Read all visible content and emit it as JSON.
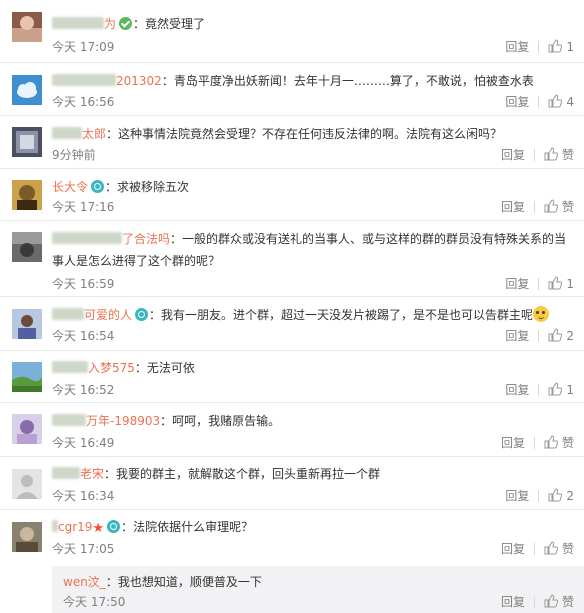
{
  "ui": {
    "reply_label": "回复",
    "like_zero_label": "赞"
  },
  "comments": [
    {
      "name_visible": "为",
      "text": "：竟然受理了",
      "time": "今天 17:09",
      "likes": "1"
    },
    {
      "name_visible": "201302",
      "text": "：青岛平度净出妖新闻！去年十月一………算了，不敢说，怕被查水表",
      "time": "今天 16:56",
      "likes": "4"
    },
    {
      "name_visible": "太郎",
      "text": "：这种事情法院竟然会受理？不存在任何违反法律的啊。法院有这么闲吗？",
      "time": "9分钟前",
      "likes": "赞"
    },
    {
      "name_visible": "长大令",
      "text": "：求被移除五次",
      "time": "今天 17:16",
      "likes": "赞"
    },
    {
      "name_visible": "了合法吗",
      "text": "：一般的群众或没有送礼的当事人、或与这样的群的群员没有特殊关系的当事人是怎么进得了这个群的呢？",
      "time": "今天 16:59",
      "likes": "1"
    },
    {
      "name_visible": "可爱的人",
      "text": "：我有一朋友。进个群，超过一天没发片被踢了，是不是也可以告群主呢",
      "time": "今天 16:54",
      "likes": "2"
    },
    {
      "name_visible": "入梦575",
      "text": "：无法可依",
      "time": "今天 16:52",
      "likes": "1"
    },
    {
      "name_visible": "万年-198903",
      "text": "：呵呵，我赌原告输。",
      "time": "今天 16:49",
      "likes": "赞"
    },
    {
      "name_visible": "老宋",
      "text": "：我要的群主，就解散这个群，回头重新再拉一个群",
      "time": "今天 16:34",
      "likes": "2"
    },
    {
      "name_visible": "cgr19",
      "text": "：法院依据什么审理呢？",
      "time": "今天 17:05",
      "likes": "赞"
    }
  ],
  "subreply": {
    "name": "wen汶_",
    "text": "：我也想知道，顺便普及一下",
    "time": "今天 17:50",
    "likes": "赞"
  },
  "colors": {
    "username": "#eb7350",
    "meta": "#808080",
    "subreply_bg": "#f2f2f5"
  },
  "icons": [
    "thumbs-up-icon",
    "verified-badge-icon",
    "vip-badge-icon",
    "star-icon",
    "emoji-icon"
  ]
}
